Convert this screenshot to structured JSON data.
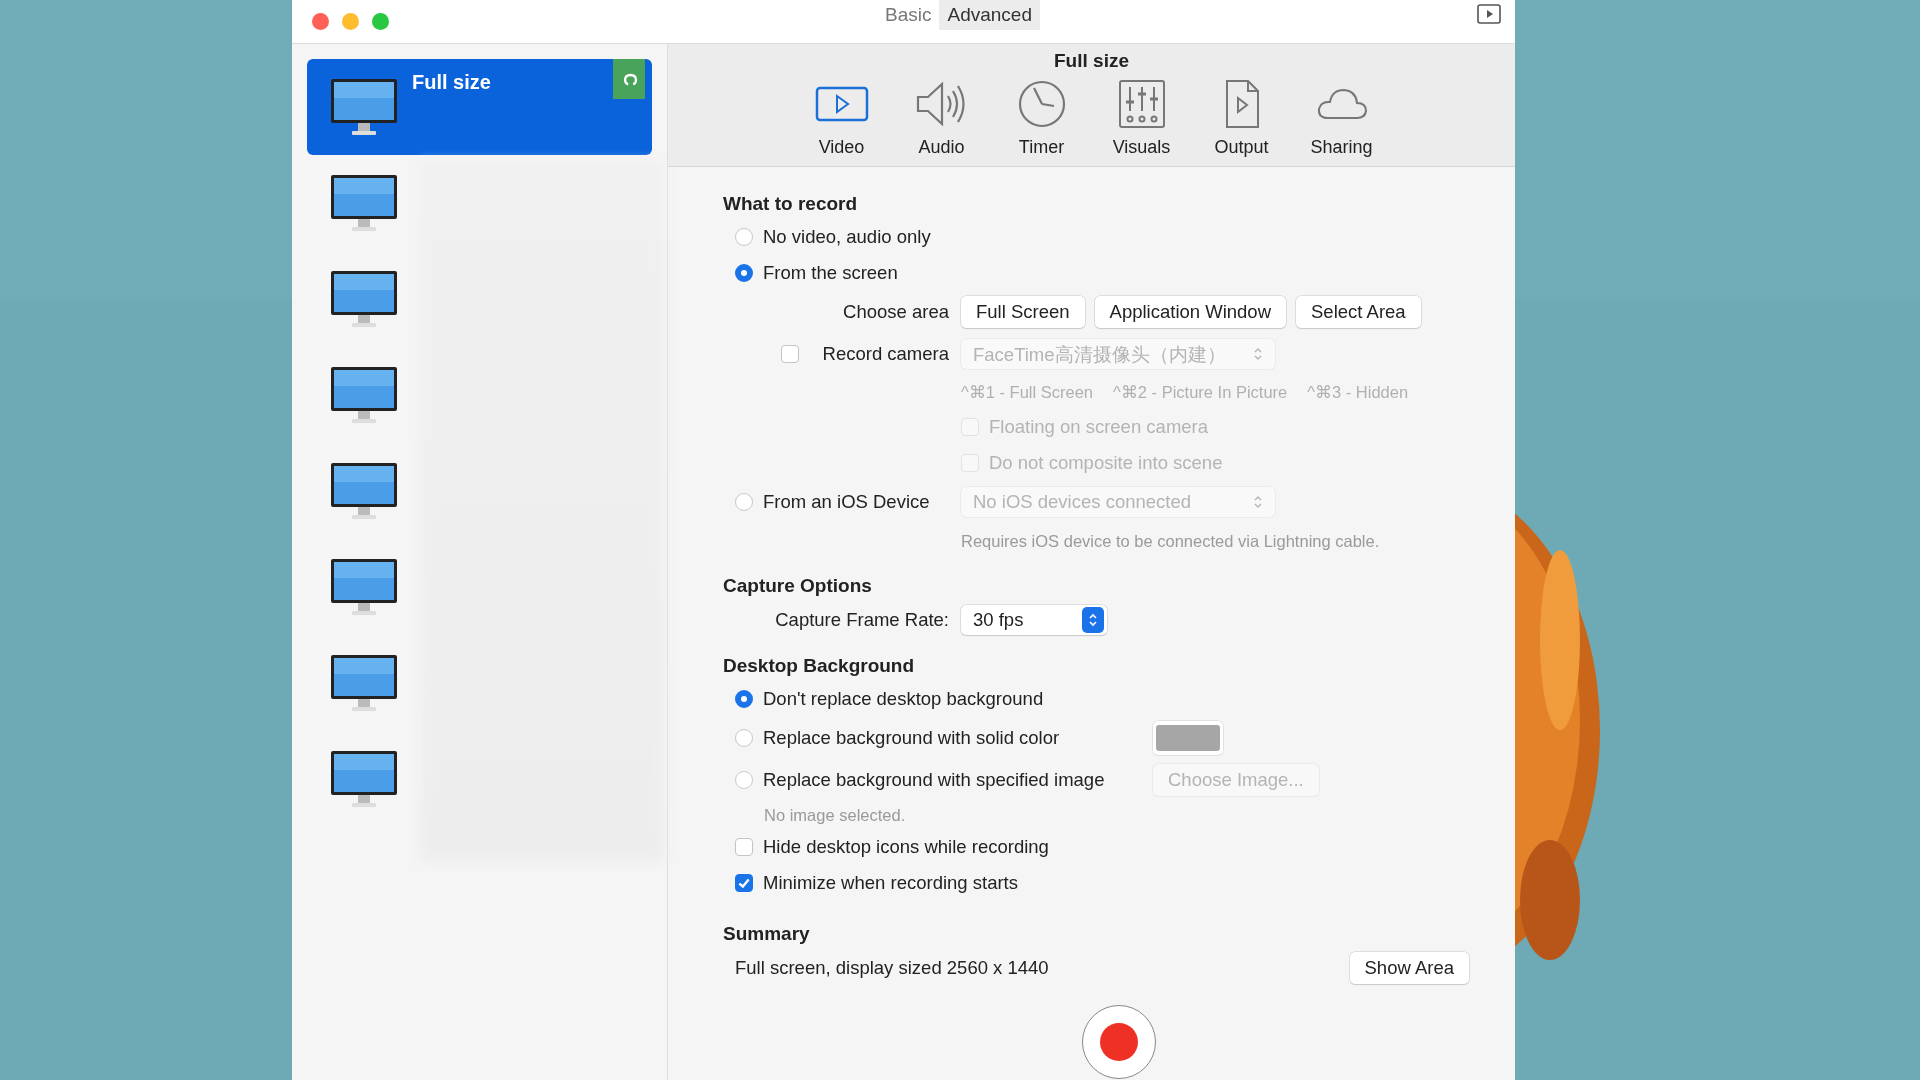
{
  "window": {
    "tabs": [
      {
        "label": "Basic",
        "selected": false
      },
      {
        "label": "Advanced",
        "selected": true
      }
    ]
  },
  "sidebar": {
    "items": [
      {
        "title": "Full size",
        "badge": "C",
        "selected": true
      },
      {
        "selected": false
      },
      {
        "selected": false
      },
      {
        "selected": false
      },
      {
        "selected": false
      },
      {
        "selected": false
      },
      {
        "selected": false
      },
      {
        "selected": false
      }
    ]
  },
  "toolbar": {
    "title": "Full size",
    "items": [
      {
        "label": "Video",
        "kind": "video",
        "selected": true
      },
      {
        "label": "Audio",
        "kind": "audio",
        "selected": false
      },
      {
        "label": "Timer",
        "kind": "timer",
        "selected": false
      },
      {
        "label": "Visuals",
        "kind": "visuals",
        "selected": false
      },
      {
        "label": "Output",
        "kind": "output",
        "selected": false
      },
      {
        "label": "Sharing",
        "kind": "sharing",
        "selected": false
      }
    ]
  },
  "what_to_record": {
    "heading": "What to record",
    "no_video": {
      "label": "No video, audio only",
      "selected": false
    },
    "from_screen": {
      "label": "From the screen",
      "selected": true
    },
    "choose_area": {
      "label": "Choose area",
      "buttons": [
        "Full Screen",
        "Application Window",
        "Select Area"
      ]
    },
    "record_camera": {
      "label": "Record camera",
      "checked": false,
      "select": "FaceTime高清摄像头（内建）",
      "disabled": true
    },
    "shortcuts": [
      "^⌘1 - Full Screen",
      "^⌘2 - Picture In Picture",
      "^⌘3 - Hidden"
    ],
    "camera_options": [
      {
        "label": "Floating on screen camera",
        "checked": false,
        "disabled": true
      },
      {
        "label": "Do not composite into scene",
        "checked": false,
        "disabled": true
      }
    ],
    "from_ios": {
      "label": "From an iOS Device",
      "selected": false,
      "select": "No iOS devices connected",
      "disabled": true
    },
    "ios_note": "Requires iOS device to be connected via Lightning cable."
  },
  "capture_options": {
    "heading": "Capture Options",
    "frame_rate": {
      "label": "Capture Frame Rate:",
      "value": "30 fps"
    }
  },
  "desktop_background": {
    "heading": "Desktop Background",
    "options": [
      {
        "label": "Don't replace desktop background",
        "selected": true,
        "kind": "plain"
      },
      {
        "label": "Replace background with solid color",
        "selected": false,
        "kind": "color"
      },
      {
        "label": "Replace background with specified image",
        "selected": false,
        "button": "Choose Image...",
        "disabled": true,
        "note": "No image selected."
      }
    ],
    "checks": [
      {
        "label": "Hide desktop icons while recording",
        "checked": false
      },
      {
        "label": "Minimize when recording starts",
        "checked": true
      }
    ]
  },
  "summary": {
    "heading": "Summary",
    "text": "Full screen, display sized 2560 x 1440",
    "button": "Show Area"
  }
}
